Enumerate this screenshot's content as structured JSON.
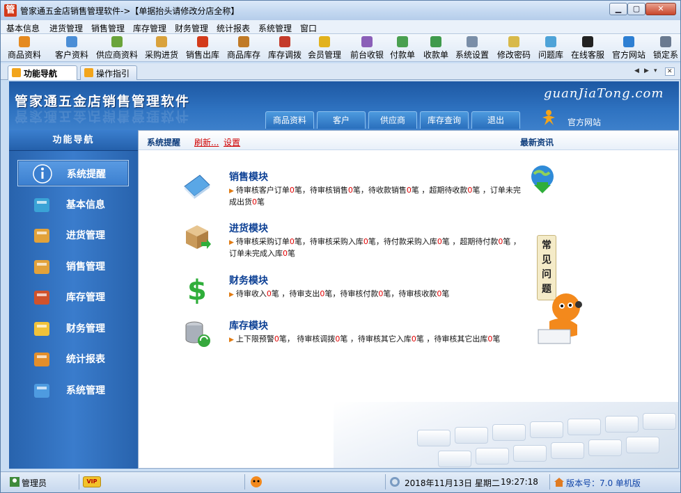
{
  "window": {
    "title": "管家通五金店销售管理软件->【单据抬头请修改分店全称】",
    "app_icon_char": "管",
    "min_glyph": "▁",
    "max_glyph": "▢",
    "close_glyph": "✕"
  },
  "menu": [
    "基本信息",
    "进货管理",
    "销售管理",
    "库存管理",
    "财务管理",
    "统计报表",
    "系统管理",
    "窗口"
  ],
  "toolbar": [
    {
      "label": "商品资料",
      "icon": "goods-icon",
      "color": "#e58a1f"
    },
    {
      "label": "客户资料",
      "icon": "customers-icon",
      "color": "#4b8ed6"
    },
    {
      "label": "供应商资料",
      "icon": "suppliers-icon",
      "color": "#6aa43a"
    },
    {
      "label": "采购进货",
      "icon": "purchase-icon",
      "color": "#d9a23c"
    },
    {
      "label": "销售出库",
      "icon": "sales-out-icon",
      "color": "#d33b1b"
    },
    {
      "label": "商品库存",
      "icon": "stock-icon",
      "color": "#c07a26"
    },
    {
      "label": "库存调拨",
      "icon": "transfer-icon",
      "color": "#c43a2a"
    },
    {
      "label": "会员管理",
      "icon": "member-icon",
      "color": "#e2b21c"
    },
    {
      "label": "前台收银",
      "icon": "cashier-icon",
      "color": "#8a5fb8"
    },
    {
      "label": "付款单",
      "icon": "payment-icon",
      "color": "#4aa050"
    },
    {
      "label": "收款单",
      "icon": "receipt-icon",
      "color": "#3f9a4c"
    },
    {
      "label": "系统设置",
      "icon": "settings-icon",
      "color": "#7a8ea8"
    },
    {
      "label": "修改密码",
      "icon": "password-icon",
      "color": "#d8b94a"
    },
    {
      "label": "问题库",
      "icon": "faq-icon",
      "color": "#4ea3d8"
    },
    {
      "label": "在线客服",
      "icon": "qq-service-icon",
      "color": "#222222"
    },
    {
      "label": "官方网站",
      "icon": "ie-icon",
      "color": "#2d7fd3"
    },
    {
      "label": "锁定系",
      "icon": "lock-icon",
      "color": "#6a7a90"
    }
  ],
  "tabs": [
    {
      "label": "功能导航",
      "active": true
    },
    {
      "label": "操作指引",
      "active": false
    }
  ],
  "tab_controls": [
    "◀",
    "▶",
    "▾",
    "✕"
  ],
  "banner": {
    "title": "管家通五金店销售管理软件",
    "site": "guanJiaTong.com",
    "tabs": [
      "商品资料",
      "客户",
      "供应商",
      "库存查询",
      "退出"
    ],
    "official_label": "官方网站"
  },
  "nav": {
    "header": "功能导航",
    "items": [
      {
        "label": "系统提醒",
        "icon": "info-icon",
        "color": "#3a7fd0",
        "active": true
      },
      {
        "label": "基本信息",
        "icon": "cubes-icon",
        "color": "#3aa3d6",
        "active": false
      },
      {
        "label": "进货管理",
        "icon": "box-in-icon",
        "color": "#e2a23a",
        "active": false
      },
      {
        "label": "销售管理",
        "icon": "box-out-icon",
        "color": "#e2a23a",
        "active": false
      },
      {
        "label": "库存管理",
        "icon": "warehouse-icon",
        "color": "#d0522c",
        "active": false
      },
      {
        "label": "财务管理",
        "icon": "finance-icon",
        "color": "#f0c23a",
        "active": false
      },
      {
        "label": "统计报表",
        "icon": "report-icon",
        "color": "#e38e2a",
        "active": false
      },
      {
        "label": "系统管理",
        "icon": "system-icon",
        "color": "#4e9be0",
        "active": false
      }
    ]
  },
  "content": {
    "system_remind": "系统提醒",
    "refresh": "刷新...",
    "settings": "设置",
    "latest_news": "最新资讯",
    "faq_sign": "常见问题",
    "modules": [
      {
        "title": "销售模块",
        "icon": "book-icon",
        "desc": "待审核客户订单0笔，待审核销售0笔，待收款销售0笔 ，超期待收款0笔 ，订单未完成出货0笔"
      },
      {
        "title": "进货模块",
        "icon": "package-icon",
        "desc": "待审核采购订单0笔，待审核采购入库0笔，待付款采购入库0笔 ，超期待付款0笔 ，订单未完成入库0笔"
      },
      {
        "title": "财务模块",
        "icon": "dollar-icon",
        "desc": "待审收入0笔 ，待审支出0笔，待审核付款0笔，待审核收款0笔"
      },
      {
        "title": "库存模块",
        "icon": "database-icon",
        "desc": "上下限预警0笔， 待审核调拨0笔 ，待审核其它入库0笔 ，待审核其它出库0笔"
      }
    ]
  },
  "status": {
    "user": "管理员",
    "vip": "VIP",
    "date": "2018年11月13日 星期二",
    "time": "19:27:18",
    "version": "版本号：7.0 单机版"
  }
}
